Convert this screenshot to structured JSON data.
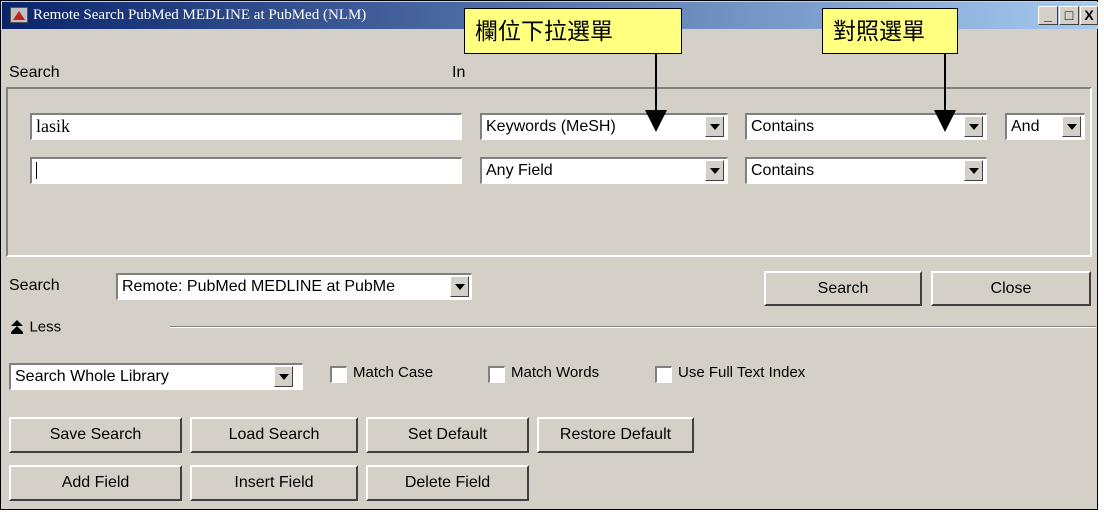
{
  "window": {
    "title": "Remote Search PubMed MEDLINE at PubMed (NLM)",
    "controls": [
      "_",
      "□",
      "X"
    ]
  },
  "labels": {
    "search": "Search",
    "in": "In",
    "search_target": "Search",
    "less": "Less"
  },
  "rows": [
    {
      "term": "lasik",
      "field": "Keywords (MeSH)",
      "comparison": "Contains",
      "bool": "And"
    },
    {
      "term": "",
      "field": "Any Field",
      "comparison": "Contains"
    }
  ],
  "search_in": {
    "value": "Remote: PubMed MEDLINE at PubMe"
  },
  "buttons": {
    "search": "Search",
    "close": "Close",
    "save_search": "Save Search",
    "load_search": "Load Search",
    "set_default": "Set Default",
    "restore_default": "Restore Default",
    "add_field": "Add Field",
    "insert_field": "Insert Field",
    "delete_field": "Delete Field"
  },
  "scope": {
    "value": "Search Whole Library"
  },
  "options": {
    "match_case": {
      "label": "Match Case",
      "checked": false
    },
    "match_words": {
      "label": "Match Words",
      "checked": false
    },
    "use_full_text": {
      "label": "Use Full Text Index",
      "checked": false
    }
  },
  "annotations": {
    "field_dropdown": "欄位下拉選單",
    "comparison_menu": "對照選單"
  },
  "icons": {
    "app": "endnote-app-icon",
    "less": "up-arrow-icon",
    "dropdown": "chevron-down-icon"
  },
  "colors": {
    "title_start": "#0a246a",
    "title_end": "#a6caf0",
    "face": "#d4d0c8",
    "note_bg": "#ffff80"
  }
}
